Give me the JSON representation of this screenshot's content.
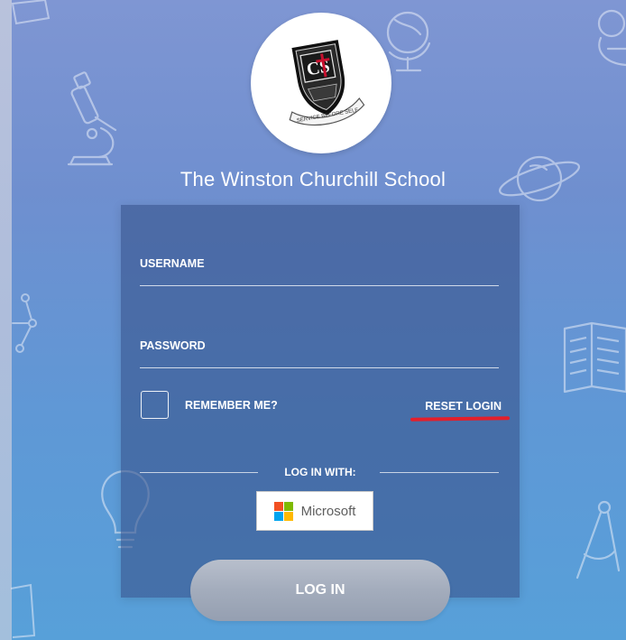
{
  "school": {
    "name": "The Winston Churchill School",
    "crest_initials": "CS",
    "crest_motto": "SERVICE BEFORE SELF"
  },
  "form": {
    "username_label": "USERNAME",
    "username_value": "",
    "password_label": "PASSWORD",
    "password_value": "",
    "remember_label": "REMEMBER ME?",
    "remember_checked": false,
    "reset_label": "RESET LOGIN",
    "login_with_label": "LOG IN WITH:",
    "microsoft_label": "Microsoft",
    "login_button_label": "LOG IN"
  },
  "icons": [
    "microscope-icon",
    "globe-icon",
    "planet-icon",
    "open-book-icon",
    "lightbulb-icon",
    "molecule-icon",
    "compass-icon",
    "microsoft-logo-icon",
    "school-crest-icon"
  ],
  "colors": {
    "background_top": "#7f96d3",
    "background_bottom": "#57a0d9",
    "card": "#38548c",
    "annotation_red": "#e31f2b",
    "button_gray": "#a3acbc",
    "ms_red": "#f25022",
    "ms_green": "#7fba00",
    "ms_blue": "#00a4ef",
    "ms_yellow": "#ffb900"
  }
}
